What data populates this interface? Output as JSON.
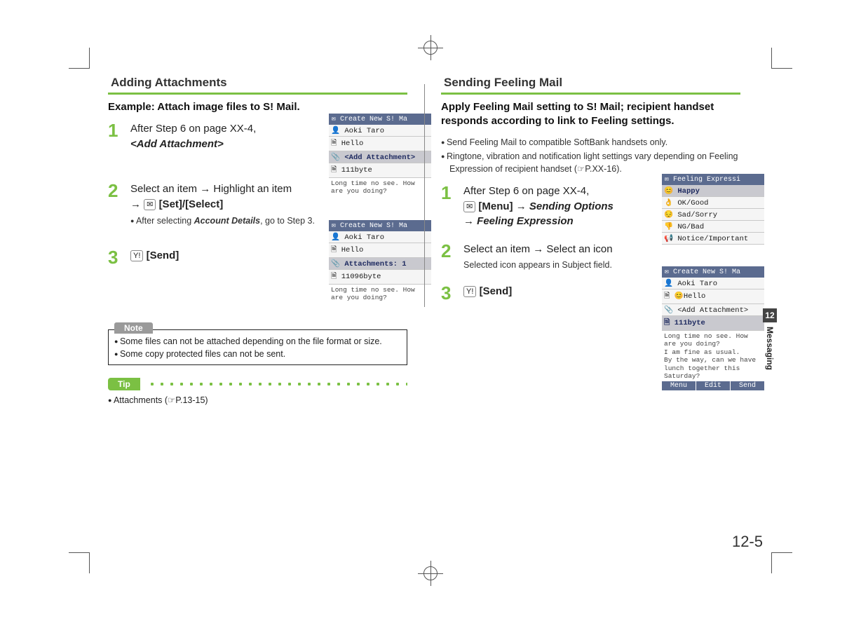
{
  "left": {
    "heading": "Adding Attachments",
    "example_label": "Example: Attach image files to S! Mail.",
    "steps": {
      "s1": {
        "num": "1",
        "line": "After Step 6 on page XX-4,",
        "strong": "<Add Attachment>"
      },
      "s2": {
        "num": "2",
        "line_a": "Select an item",
        "arrow1": "→",
        "line_b": "Highlight an item",
        "arrow2": "→",
        "key_icon": "✉",
        "key_text": "[Set]/[Select]",
        "sub_a": "After selecting ",
        "sub_strong": "Account Details",
        "sub_b": ", go to Step 3."
      },
      "s3": {
        "num": "3",
        "key_icon": "Y!",
        "key_text": "[Send]"
      }
    },
    "screenshot1": {
      "title": "✉ Create New S! Ma",
      "r1": "👤 Aoki Taro",
      "r2": "🗎 Hello",
      "r3": "📎 <Add Attachment>",
      "r4": "🗎 111byte",
      "msg": "Long time no see. How are you doing?"
    },
    "screenshot2": {
      "title": "✉ Create New S! Ma",
      "r1": "👤 Aoki Taro",
      "r2": "🗎 Hello",
      "r3": "📎 Attachments: 1",
      "r4": "🗎 11096byte",
      "msg": "Long time no see. How are you doing?"
    },
    "note": {
      "label": "Note",
      "n1": "Some files can not be attached depending on the file format or size.",
      "n2": "Some copy protected files can not be sent."
    },
    "tip": {
      "label": "Tip",
      "line": "Attachments (☞P.13-15)"
    }
  },
  "right": {
    "heading": "Sending Feeling Mail",
    "intro": "Apply Feeling Mail setting to S! Mail; recipient handset responds according to link to Feeling settings.",
    "bullets": {
      "b1": "Send Feeling Mail to compatible SoftBank handsets only.",
      "b2": "Ringtone, vibration and notification light settings vary depending on Feeling Expression of recipient handset (☞P.XX-16)."
    },
    "steps": {
      "s1": {
        "num": "1",
        "line": "After Step 6 on page XX-4,",
        "key_icon": "✉",
        "key_text": "[Menu]",
        "arrow1": "→",
        "strong1": "Sending Options",
        "arrow2": "→",
        "strong2": "Feeling Expression"
      },
      "s2": {
        "num": "2",
        "line_a": "Select an item",
        "arrow1": "→",
        "line_b": "Select an icon",
        "sub": "Selected icon appears in Subject field."
      },
      "s3": {
        "num": "3",
        "key_icon": "Y!",
        "key_text": "[Send]"
      }
    },
    "screenshot1": {
      "title": "✉ Feeling Expressi",
      "r1": "😊 Happy",
      "r2": "👌 OK/Good",
      "r3": "😔 Sad/Sorry",
      "r4": "👎 NG/Bad",
      "r5": "📢 Notice/Important"
    },
    "screenshot2": {
      "title": "✉ Create New S! Ma",
      "r1": "👤 Aoki Taro",
      "r2": "🗎 😊Hello",
      "r3": "📎 <Add Attachment>",
      "r4": "🗎 111byte",
      "msg": "Long time no see. How are you doing?\nI am fine as usual.\nBy the way, can we have lunch together this Saturday?",
      "k1": "Menu",
      "k2": "Edit",
      "k3": "Send"
    }
  },
  "side": {
    "chapter": "12",
    "label": "Messaging"
  },
  "page_number": "12-5"
}
